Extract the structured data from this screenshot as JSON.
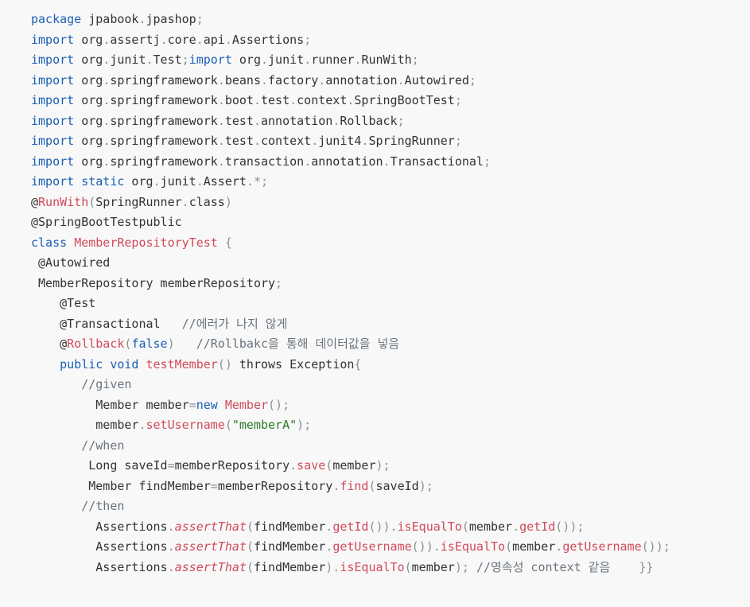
{
  "colors": {
    "background": "#f8f8f8",
    "text": "#333333",
    "keyword": "#1a5fb4",
    "identifier_highlight": "#d14a5a",
    "string": "#2a7a2a",
    "comment": "#6a737d"
  },
  "code": {
    "lines": [
      {
        "indent": "",
        "tokens": [
          {
            "t": "kw",
            "v": "package"
          },
          {
            "t": "",
            "v": " jpabook"
          },
          {
            "t": "pu",
            "v": "."
          },
          {
            "t": "",
            "v": "jpashop"
          },
          {
            "t": "pu",
            "v": ";"
          }
        ]
      },
      {
        "indent": "",
        "tokens": [
          {
            "t": "kw",
            "v": "import"
          },
          {
            "t": "",
            "v": " org"
          },
          {
            "t": "pu",
            "v": "."
          },
          {
            "t": "",
            "v": "assertj"
          },
          {
            "t": "pu",
            "v": "."
          },
          {
            "t": "",
            "v": "core"
          },
          {
            "t": "pu",
            "v": "."
          },
          {
            "t": "",
            "v": "api"
          },
          {
            "t": "pu",
            "v": "."
          },
          {
            "t": "",
            "v": "Assertions"
          },
          {
            "t": "pu",
            "v": ";"
          }
        ]
      },
      {
        "indent": "",
        "tokens": [
          {
            "t": "kw",
            "v": "import"
          },
          {
            "t": "",
            "v": " org"
          },
          {
            "t": "pu",
            "v": "."
          },
          {
            "t": "",
            "v": "junit"
          },
          {
            "t": "pu",
            "v": "."
          },
          {
            "t": "",
            "v": "Test"
          },
          {
            "t": "pu",
            "v": ";"
          },
          {
            "t": "kw",
            "v": "import"
          },
          {
            "t": "",
            "v": " org"
          },
          {
            "t": "pu",
            "v": "."
          },
          {
            "t": "",
            "v": "junit"
          },
          {
            "t": "pu",
            "v": "."
          },
          {
            "t": "",
            "v": "runner"
          },
          {
            "t": "pu",
            "v": "."
          },
          {
            "t": "",
            "v": "RunWith"
          },
          {
            "t": "pu",
            "v": ";"
          }
        ]
      },
      {
        "indent": "",
        "tokens": [
          {
            "t": "kw",
            "v": "import"
          },
          {
            "t": "",
            "v": " org"
          },
          {
            "t": "pu",
            "v": "."
          },
          {
            "t": "",
            "v": "springframework"
          },
          {
            "t": "pu",
            "v": "."
          },
          {
            "t": "",
            "v": "beans"
          },
          {
            "t": "pu",
            "v": "."
          },
          {
            "t": "",
            "v": "factory"
          },
          {
            "t": "pu",
            "v": "."
          },
          {
            "t": "",
            "v": "annotation"
          },
          {
            "t": "pu",
            "v": "."
          },
          {
            "t": "",
            "v": "Autowired"
          },
          {
            "t": "pu",
            "v": ";"
          }
        ]
      },
      {
        "indent": "",
        "tokens": [
          {
            "t": "kw",
            "v": "import"
          },
          {
            "t": "",
            "v": " org"
          },
          {
            "t": "pu",
            "v": "."
          },
          {
            "t": "",
            "v": "springframework"
          },
          {
            "t": "pu",
            "v": "."
          },
          {
            "t": "",
            "v": "boot"
          },
          {
            "t": "pu",
            "v": "."
          },
          {
            "t": "",
            "v": "test"
          },
          {
            "t": "pu",
            "v": "."
          },
          {
            "t": "",
            "v": "context"
          },
          {
            "t": "pu",
            "v": "."
          },
          {
            "t": "",
            "v": "SpringBootTest"
          },
          {
            "t": "pu",
            "v": ";"
          }
        ]
      },
      {
        "indent": "",
        "tokens": [
          {
            "t": "kw",
            "v": "import"
          },
          {
            "t": "",
            "v": " org"
          },
          {
            "t": "pu",
            "v": "."
          },
          {
            "t": "",
            "v": "springframework"
          },
          {
            "t": "pu",
            "v": "."
          },
          {
            "t": "",
            "v": "test"
          },
          {
            "t": "pu",
            "v": "."
          },
          {
            "t": "",
            "v": "annotation"
          },
          {
            "t": "pu",
            "v": "."
          },
          {
            "t": "",
            "v": "Rollback"
          },
          {
            "t": "pu",
            "v": ";"
          }
        ]
      },
      {
        "indent": "",
        "tokens": [
          {
            "t": "kw",
            "v": "import"
          },
          {
            "t": "",
            "v": " org"
          },
          {
            "t": "pu",
            "v": "."
          },
          {
            "t": "",
            "v": "springframework"
          },
          {
            "t": "pu",
            "v": "."
          },
          {
            "t": "",
            "v": "test"
          },
          {
            "t": "pu",
            "v": "."
          },
          {
            "t": "",
            "v": "context"
          },
          {
            "t": "pu",
            "v": "."
          },
          {
            "t": "",
            "v": "junit4"
          },
          {
            "t": "pu",
            "v": "."
          },
          {
            "t": "",
            "v": "SpringRunner"
          },
          {
            "t": "pu",
            "v": ";"
          }
        ]
      },
      {
        "indent": "",
        "tokens": [
          {
            "t": "kw",
            "v": "import"
          },
          {
            "t": "",
            "v": " org"
          },
          {
            "t": "pu",
            "v": "."
          },
          {
            "t": "",
            "v": "springframework"
          },
          {
            "t": "pu",
            "v": "."
          },
          {
            "t": "",
            "v": "transaction"
          },
          {
            "t": "pu",
            "v": "."
          },
          {
            "t": "",
            "v": "annotation"
          },
          {
            "t": "pu",
            "v": "."
          },
          {
            "t": "",
            "v": "Transactional"
          },
          {
            "t": "pu",
            "v": ";"
          }
        ]
      },
      {
        "indent": "",
        "tokens": [
          {
            "t": "kw",
            "v": "import"
          },
          {
            "t": "",
            "v": " "
          },
          {
            "t": "kw",
            "v": "static"
          },
          {
            "t": "",
            "v": " org"
          },
          {
            "t": "pu",
            "v": "."
          },
          {
            "t": "",
            "v": "junit"
          },
          {
            "t": "pu",
            "v": "."
          },
          {
            "t": "",
            "v": "Assert"
          },
          {
            "t": "pu",
            "v": ".*;"
          }
        ]
      },
      {
        "indent": "",
        "tokens": [
          {
            "t": "",
            "v": "@"
          },
          {
            "t": "ty",
            "v": "RunWith"
          },
          {
            "t": "pu",
            "v": "("
          },
          {
            "t": "",
            "v": "SpringRunner"
          },
          {
            "t": "pu",
            "v": "."
          },
          {
            "t": "",
            "v": "class"
          },
          {
            "t": "pu",
            "v": ")"
          }
        ]
      },
      {
        "indent": "",
        "tokens": [
          {
            "t": "",
            "v": "@SpringBootTestpublic"
          }
        ]
      },
      {
        "indent": "",
        "tokens": [
          {
            "t": "kw",
            "v": "class"
          },
          {
            "t": "",
            "v": " "
          },
          {
            "t": "ty",
            "v": "MemberRepositoryTest"
          },
          {
            "t": "",
            "v": " "
          },
          {
            "t": "pu",
            "v": "{"
          }
        ]
      },
      {
        "indent": " ",
        "tokens": [
          {
            "t": "",
            "v": "@Autowired"
          }
        ]
      },
      {
        "indent": " ",
        "tokens": [
          {
            "t": "",
            "v": "MemberRepository memberRepository"
          },
          {
            "t": "pu",
            "v": ";"
          }
        ]
      },
      {
        "indent": "    ",
        "tokens": [
          {
            "t": "",
            "v": "@Test"
          }
        ]
      },
      {
        "indent": "    ",
        "tokens": [
          {
            "t": "",
            "v": "@Transactional   "
          },
          {
            "t": "cm",
            "v": "//에러가 나지 않게"
          }
        ]
      },
      {
        "indent": "    ",
        "tokens": [
          {
            "t": "",
            "v": "@"
          },
          {
            "t": "ty",
            "v": "Rollback"
          },
          {
            "t": "pu",
            "v": "("
          },
          {
            "t": "kw",
            "v": "false"
          },
          {
            "t": "pu",
            "v": ")"
          },
          {
            "t": "",
            "v": "   "
          },
          {
            "t": "cm",
            "v": "//Rollbakc을 통해 데이터값을 넣음"
          }
        ]
      },
      {
        "indent": "    ",
        "tokens": [
          {
            "t": "kw",
            "v": "public"
          },
          {
            "t": "",
            "v": " "
          },
          {
            "t": "kw",
            "v": "void"
          },
          {
            "t": "",
            "v": " "
          },
          {
            "t": "fn",
            "v": "testMember"
          },
          {
            "t": "pu",
            "v": "()"
          },
          {
            "t": "",
            "v": " throws Exception"
          },
          {
            "t": "pu",
            "v": "{"
          }
        ]
      },
      {
        "indent": "       ",
        "tokens": [
          {
            "t": "cm",
            "v": "//given"
          }
        ]
      },
      {
        "indent": "         ",
        "tokens": [
          {
            "t": "",
            "v": "Member member"
          },
          {
            "t": "pu",
            "v": "="
          },
          {
            "t": "kw",
            "v": "new"
          },
          {
            "t": "",
            "v": " "
          },
          {
            "t": "ty",
            "v": "Member"
          },
          {
            "t": "pu",
            "v": "();"
          }
        ]
      },
      {
        "indent": "         ",
        "tokens": [
          {
            "t": "",
            "v": "member"
          },
          {
            "t": "pu",
            "v": "."
          },
          {
            "t": "fn",
            "v": "setUsername"
          },
          {
            "t": "pu",
            "v": "("
          },
          {
            "t": "str",
            "v": "\"memberA\""
          },
          {
            "t": "pu",
            "v": ");"
          }
        ]
      },
      {
        "indent": "       ",
        "tokens": [
          {
            "t": "cm",
            "v": "//when"
          }
        ]
      },
      {
        "indent": "        ",
        "tokens": [
          {
            "t": "",
            "v": "Long saveId"
          },
          {
            "t": "pu",
            "v": "="
          },
          {
            "t": "",
            "v": "memberRepository"
          },
          {
            "t": "pu",
            "v": "."
          },
          {
            "t": "fn",
            "v": "save"
          },
          {
            "t": "pu",
            "v": "("
          },
          {
            "t": "",
            "v": "member"
          },
          {
            "t": "pu",
            "v": ");"
          }
        ]
      },
      {
        "indent": "        ",
        "tokens": [
          {
            "t": "",
            "v": "Member findMember"
          },
          {
            "t": "pu",
            "v": "="
          },
          {
            "t": "",
            "v": "memberRepository"
          },
          {
            "t": "pu",
            "v": "."
          },
          {
            "t": "fn",
            "v": "find"
          },
          {
            "t": "pu",
            "v": "("
          },
          {
            "t": "",
            "v": "saveId"
          },
          {
            "t": "pu",
            "v": ");"
          }
        ]
      },
      {
        "indent": "       ",
        "tokens": [
          {
            "t": "cm",
            "v": "//then"
          }
        ]
      },
      {
        "indent": "         ",
        "tokens": [
          {
            "t": "",
            "v": "Assertions"
          },
          {
            "t": "pu",
            "v": "."
          },
          {
            "t": "it",
            "v": "assertThat"
          },
          {
            "t": "pu",
            "v": "("
          },
          {
            "t": "",
            "v": "findMember"
          },
          {
            "t": "pu",
            "v": "."
          },
          {
            "t": "fn",
            "v": "getId"
          },
          {
            "t": "pu",
            "v": "())."
          },
          {
            "t": "fn",
            "v": "isEqualTo"
          },
          {
            "t": "pu",
            "v": "("
          },
          {
            "t": "",
            "v": "member"
          },
          {
            "t": "pu",
            "v": "."
          },
          {
            "t": "fn",
            "v": "getId"
          },
          {
            "t": "pu",
            "v": "());"
          }
        ]
      },
      {
        "indent": "         ",
        "tokens": [
          {
            "t": "",
            "v": "Assertions"
          },
          {
            "t": "pu",
            "v": "."
          },
          {
            "t": "it",
            "v": "assertThat"
          },
          {
            "t": "pu",
            "v": "("
          },
          {
            "t": "",
            "v": "findMember"
          },
          {
            "t": "pu",
            "v": "."
          },
          {
            "t": "fn",
            "v": "getUsername"
          },
          {
            "t": "pu",
            "v": "())."
          },
          {
            "t": "fn",
            "v": "isEqualTo"
          },
          {
            "t": "pu",
            "v": "("
          },
          {
            "t": "",
            "v": "member"
          },
          {
            "t": "pu",
            "v": "."
          },
          {
            "t": "fn",
            "v": "getUsername"
          },
          {
            "t": "pu",
            "v": "());"
          }
        ]
      },
      {
        "indent": "         ",
        "tokens": [
          {
            "t": "",
            "v": "Assertions"
          },
          {
            "t": "pu",
            "v": "."
          },
          {
            "t": "it",
            "v": "assertThat"
          },
          {
            "t": "pu",
            "v": "("
          },
          {
            "t": "",
            "v": "findMember"
          },
          {
            "t": "pu",
            "v": ")."
          },
          {
            "t": "fn",
            "v": "isEqualTo"
          },
          {
            "t": "pu",
            "v": "("
          },
          {
            "t": "",
            "v": "member"
          },
          {
            "t": "pu",
            "v": ");"
          },
          {
            "t": "",
            "v": " "
          },
          {
            "t": "cm",
            "v": "//영속성 context 같음"
          },
          {
            "t": "",
            "v": "    "
          },
          {
            "t": "pu",
            "v": "}}"
          }
        ]
      }
    ]
  }
}
